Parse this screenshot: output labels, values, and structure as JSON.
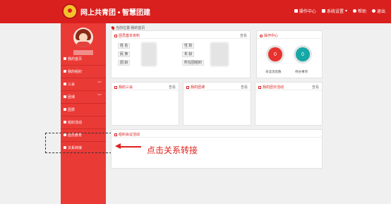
{
  "header": {
    "title": "网上共青团 • 智慧团建",
    "nav": [
      "操作中心",
      "系统设置",
      "帮助",
      "退出"
    ]
  },
  "sidebar": {
    "items": [
      {
        "label": "我的首页",
        "icon": "home-icon"
      },
      {
        "label": "我的组织",
        "icon": "organization-icon"
      },
      {
        "label": "三会",
        "icon": "meeting-icon",
        "chevron": "﹀"
      },
      {
        "label": "团课",
        "icon": "folder-icon",
        "chevron": "﹀"
      },
      {
        "label": "团费",
        "icon": "fee-icon"
      },
      {
        "label": "组织活动",
        "icon": "activity-icon"
      },
      {
        "label": "团员教育",
        "icon": "education-icon"
      },
      {
        "label": "关系转接",
        "icon": "transfer-icon"
      }
    ]
  },
  "breadcrumb": "当前位置:我的首页",
  "panels": {
    "basic_info": {
      "title": "团员基本资料",
      "more": "查看",
      "fields_left": [
        "姓    名",
        "民    族",
        "团    龄"
      ],
      "fields_right": [
        "性    别",
        "年    龄",
        "所在团组织"
      ]
    },
    "ops": {
      "title": "操作中心",
      "circles": [
        {
          "value": "0",
          "label": "未读消息数",
          "color": "#e8322e"
        },
        {
          "value": "0",
          "label": "待办事项",
          "color": "#16a7a7"
        }
      ]
    },
    "three": {
      "title": "我的三会",
      "more": "查看"
    },
    "lesson": {
      "title": "我的团课",
      "more": "查看"
    },
    "activity": {
      "title": "我的团日活动",
      "more": "查看"
    },
    "org_meeting": {
      "title": "组织会议活动"
    }
  },
  "annotation": {
    "text": "点击关系转接",
    "color": "#e0201c"
  }
}
